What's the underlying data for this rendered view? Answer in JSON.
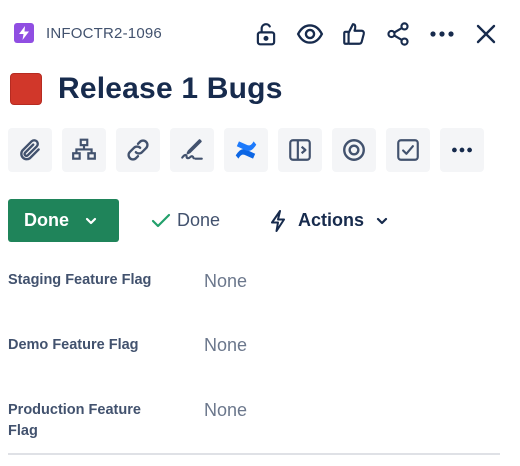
{
  "header": {
    "issue_key": "INFOCTR2-1096",
    "issue_type_icon": "lightning-icon",
    "issue_type_color": "#904ee2",
    "actions": [
      "unlock-icon",
      "watch-eye-icon",
      "thumbs-up-icon",
      "share-icon",
      "more-icon",
      "close-icon"
    ]
  },
  "title": {
    "text": "Release 1 Bugs",
    "swatch_color": "#d1372a"
  },
  "toolbar": {
    "buttons": [
      "attach-icon",
      "child-issues-icon",
      "link-icon",
      "signature-icon",
      "confluence-icon",
      "panel-icon",
      "target-icon",
      "checklist-icon",
      "more-icon"
    ]
  },
  "status": {
    "label": "Done",
    "color": "#1f845a",
    "resolution": "Done",
    "actions_label": "Actions"
  },
  "fields": [
    {
      "label": "Staging Feature Flag",
      "value": "None"
    },
    {
      "label": "Demo Feature Flag",
      "value": "None"
    },
    {
      "label": "Production Feature Flag",
      "value": "None"
    }
  ]
}
